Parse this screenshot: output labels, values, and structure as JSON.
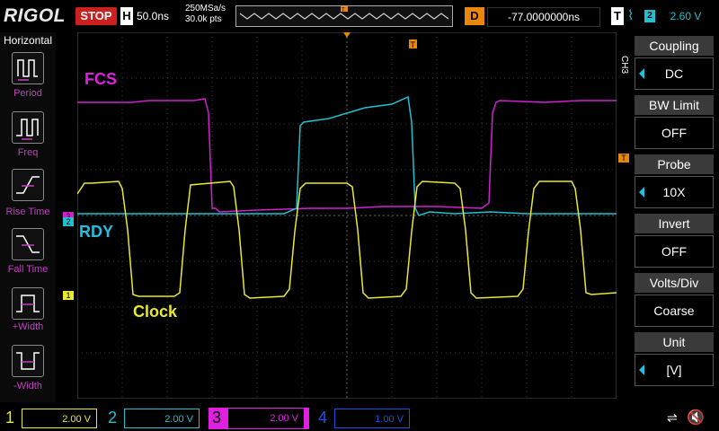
{
  "topbar": {
    "logo": "RIGOL",
    "run_state": "STOP",
    "h_label": "H",
    "timebase": "50.0ns",
    "sample_rate": "250MSa/s",
    "mem_depth": "30.0k pts",
    "d_label": "D",
    "delay": "-77.0000000ns",
    "t_label": "T",
    "trigger_edge": "⌇",
    "trigger_source": "2",
    "trigger_level": "2.60 V"
  },
  "left_panel": {
    "title": "Horizontal",
    "items": [
      {
        "label": "Period",
        "icon": "period-icon"
      },
      {
        "label": "Freq",
        "icon": "freq-icon"
      },
      {
        "label": "Rise Time",
        "icon": "rise-time-icon"
      },
      {
        "label": "Fall Time",
        "icon": "fall-time-icon"
      },
      {
        "label": "+Width",
        "icon": "pos-width-icon"
      },
      {
        "label": "-Width",
        "icon": "neg-width-icon"
      }
    ]
  },
  "right_panel": {
    "channel_tag": "CH3",
    "items": [
      {
        "header": "Coupling",
        "value": "DC"
      },
      {
        "header": "BW Limit",
        "value": "OFF"
      },
      {
        "header": "Probe",
        "value": "10X"
      },
      {
        "header": "Invert",
        "value": "OFF"
      },
      {
        "header": "Volts/Div",
        "value": "Coarse"
      },
      {
        "header": "Unit",
        "value": "[V]"
      }
    ]
  },
  "waveform_labels": {
    "fcs": "FCS",
    "rdy": "RDY",
    "clock": "Clock"
  },
  "channels": [
    {
      "num": "1",
      "scale": "2.00 V",
      "color": "#e8e830"
    },
    {
      "num": "2",
      "scale": "2.00 V",
      "color": "#20c0d0"
    },
    {
      "num": "3",
      "scale": "2.00 V",
      "color": "#e020e0"
    },
    {
      "num": "4",
      "scale": "1.00 V",
      "color": "#2050e0"
    }
  ],
  "colors": {
    "ch1": "#e8e830",
    "ch2": "#20c0d0",
    "ch3": "#d020d0",
    "accent_orange": "#e8870b",
    "stop_red": "#cc2020"
  },
  "markers": {
    "ch1": "1",
    "ch2": "2",
    "ch3": "3"
  }
}
